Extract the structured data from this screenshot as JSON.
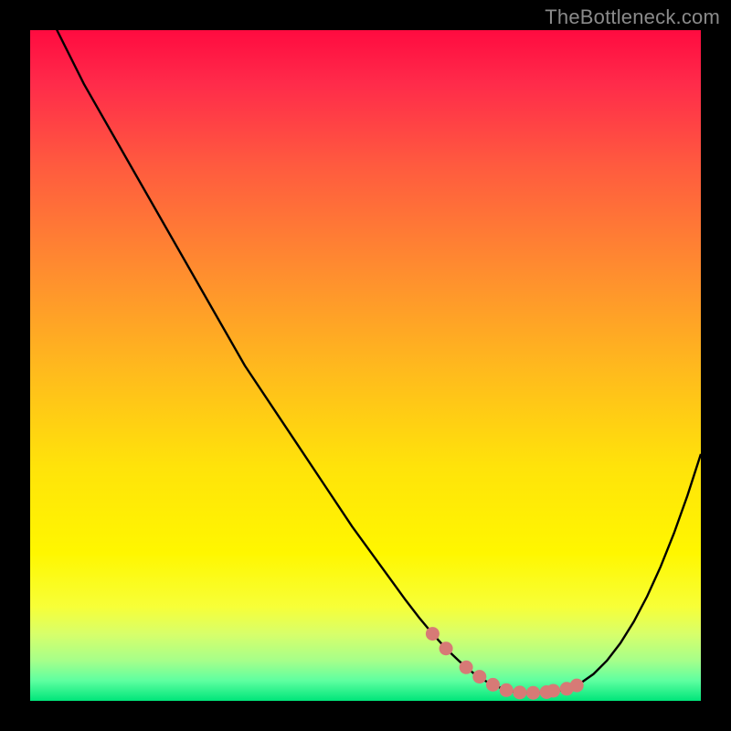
{
  "watermark": "TheBottleneck.com",
  "colors": {
    "background": "#000000",
    "curve": "#000000",
    "marker_fill": "#d77a76",
    "marker_stroke": "#d77a76",
    "gradient_top": "#ff0b40",
    "gradient_bottom": "#00e57a"
  },
  "chart_data": {
    "type": "line",
    "title": "",
    "xlabel": "",
    "ylabel": "",
    "xlim": [
      0,
      100
    ],
    "ylim": [
      0,
      100
    ],
    "x": [
      0,
      4,
      8,
      12,
      16,
      20,
      24,
      28,
      32,
      36,
      40,
      44,
      48,
      52,
      56,
      58,
      60,
      62,
      64,
      66,
      68,
      69,
      70,
      72,
      74,
      76,
      78,
      80,
      82,
      84,
      86,
      88,
      90,
      92,
      94,
      96,
      98,
      100
    ],
    "values": [
      108,
      100,
      92,
      85,
      78,
      71,
      64,
      57,
      50,
      44,
      38,
      32,
      26,
      20.5,
      15,
      12.4,
      10,
      7.8,
      5.9,
      4.2,
      2.9,
      2.4,
      2.0,
      1.4,
      1.2,
      1.2,
      1.3,
      1.8,
      2.6,
      4.0,
      6.0,
      8.6,
      11.8,
      15.6,
      20.0,
      25.0,
      30.6,
      36.8
    ],
    "highlighted_points_x": [
      60,
      62,
      65,
      67,
      69,
      71,
      73,
      75,
      77,
      78,
      80,
      81.5
    ],
    "highlighted_points_y": [
      10,
      7.8,
      5.0,
      3.6,
      2.4,
      1.6,
      1.25,
      1.2,
      1.3,
      1.5,
      1.8,
      2.3
    ]
  }
}
